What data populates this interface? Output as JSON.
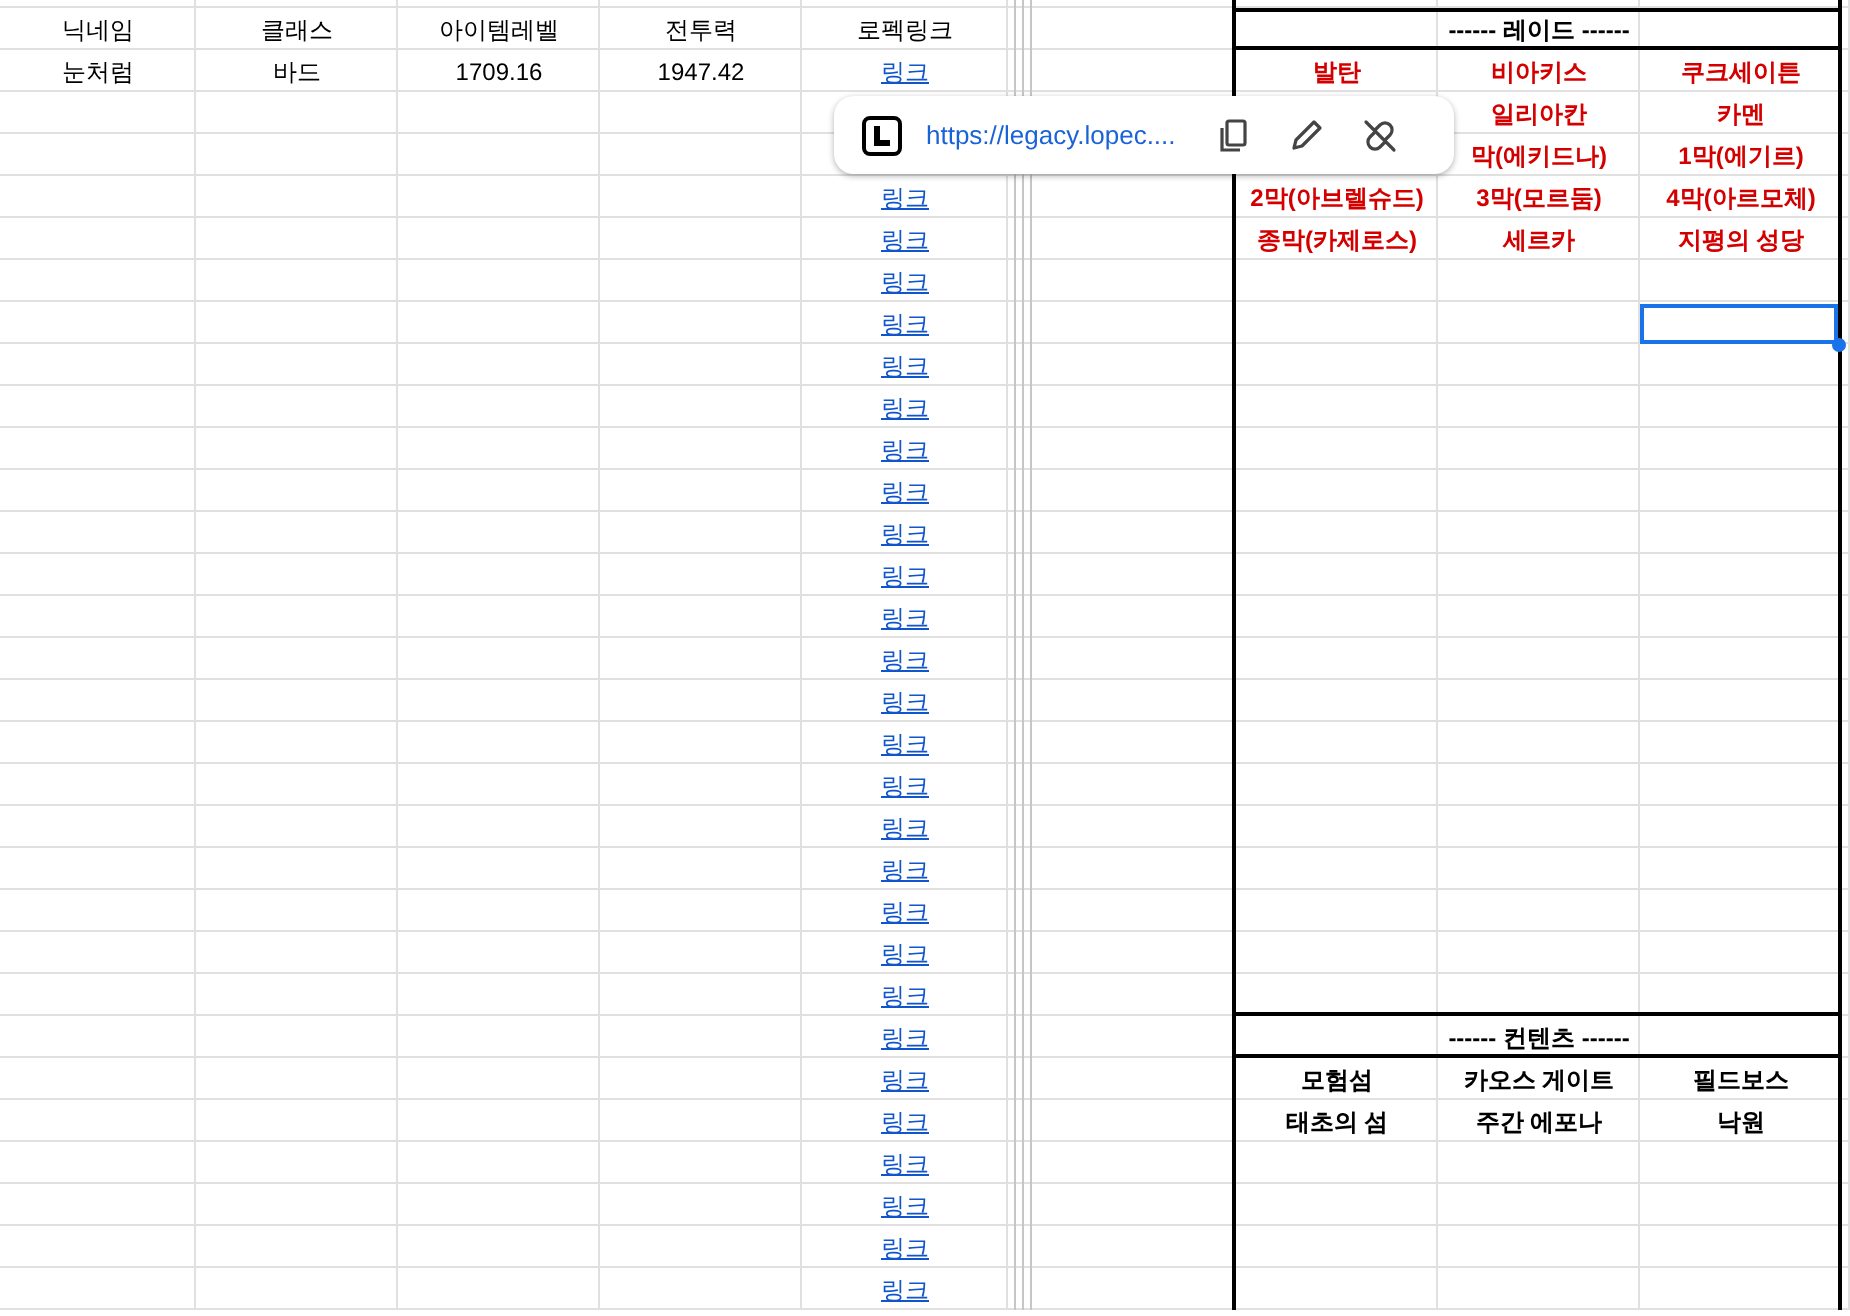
{
  "table": {
    "columns": [
      "닉네임",
      "클래스",
      "아이템레벨",
      "전투력",
      "로펙링크"
    ],
    "rows": [
      [
        "눈처럼",
        "바드",
        "1709.16",
        "1947.42",
        "링크"
      ]
    ],
    "link_cells": [
      "링크",
      "링크",
      "링크",
      "링크",
      "링크",
      "링크",
      "링크",
      "링크",
      "링크",
      "링크",
      "링크",
      "링크",
      "링크",
      "링크",
      "링크",
      "링크",
      "링크",
      "링크",
      "링크",
      "링크",
      "링크",
      "링크",
      "링크",
      "링크",
      "링크",
      "링크",
      "링크"
    ]
  },
  "raid": {
    "title": "------ 레이드 ------",
    "rows": [
      {
        "cells": [
          "발탄",
          "비아키스",
          "쿠크세이튼"
        ]
      },
      {
        "cells": [
          null,
          "일리아칸",
          "카멘"
        ]
      },
      {
        "cells": [
          null,
          "막(에키드나)",
          "1막(에기르)"
        ]
      },
      {
        "cells": [
          "2막(아브렐슈드)",
          "3막(모르둠)",
          "4막(아르모체)"
        ]
      },
      {
        "cells": [
          "종막(카제로스)",
          "세르카",
          "지평의 성당"
        ]
      }
    ]
  },
  "contents": {
    "title": "------ 컨텐츠 ------",
    "rows": [
      {
        "cells": [
          "모험섬",
          "카오스 게이트",
          "필드보스"
        ]
      },
      {
        "cells": [
          "태초의 섬",
          "주간 에포나",
          "낙원"
        ]
      }
    ]
  },
  "link_popup": {
    "url": "https://legacy.lopec...."
  }
}
